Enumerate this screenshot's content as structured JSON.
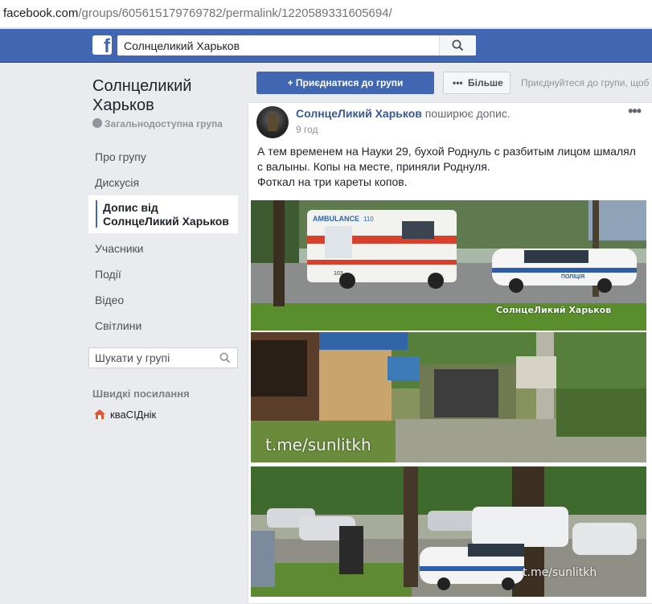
{
  "browser": {
    "url_host": "facebook.com",
    "url_path": "/groups/605615179769782/permalink/1220589331605694/"
  },
  "header": {
    "logo": "f",
    "search_value": "Солнцеликий Харьков",
    "search_icon": "search-icon"
  },
  "sidebar": {
    "group_title": "Солнцеликий Харьков",
    "privacy": "Загальнодоступна група",
    "nav": [
      {
        "label": "Про групу"
      },
      {
        "label": "Дискусія"
      },
      {
        "label": "Допис від СолнцеЛикий Харьков"
      },
      {
        "label": "Учасники"
      },
      {
        "label": "Події"
      },
      {
        "label": "Відео"
      },
      {
        "label": "Світлини"
      }
    ],
    "search_placeholder": "Шукати у групі",
    "quick_links_title": "Швидкі посилання",
    "quick_links": [
      {
        "label": "кваСІДнік",
        "icon": "home-icon"
      }
    ]
  },
  "actions": {
    "join_label": "Приєднатися до групи",
    "more_label": "Більше",
    "join_hint": "Приєднуйтеся до групи, щоб"
  },
  "post": {
    "author": "СолнцеЛикий Харьков",
    "action": "поширює допис.",
    "time": "9 год",
    "text_line1": "А тем временем на Науки 29, бухой Роднуль с разбитым лицом шмалял",
    "text_line2": "с валыны. Копы на месте, приняли Роднуля.",
    "text_line3": "Фоткал на три кареты копов.",
    "photos": [
      {
        "alt": "ambulance and police car",
        "ambulance_label": "AMBULANCE",
        "ambulance_number": "110",
        "ambulance_side": "103",
        "police_label": "ПОЛІЦІЯ",
        "watermark": "СолнцеЛикий Харьков"
      },
      {
        "alt": "kiosk and crowd",
        "watermark": "t.me/sunlitkh"
      },
      {
        "alt": "police cars in parking lot",
        "watermark": "t.me/sunlitkh"
      }
    ]
  },
  "colors": {
    "fb_blue": "#4267b2",
    "link_blue": "#365899",
    "page_bg": "#e9ebee"
  }
}
